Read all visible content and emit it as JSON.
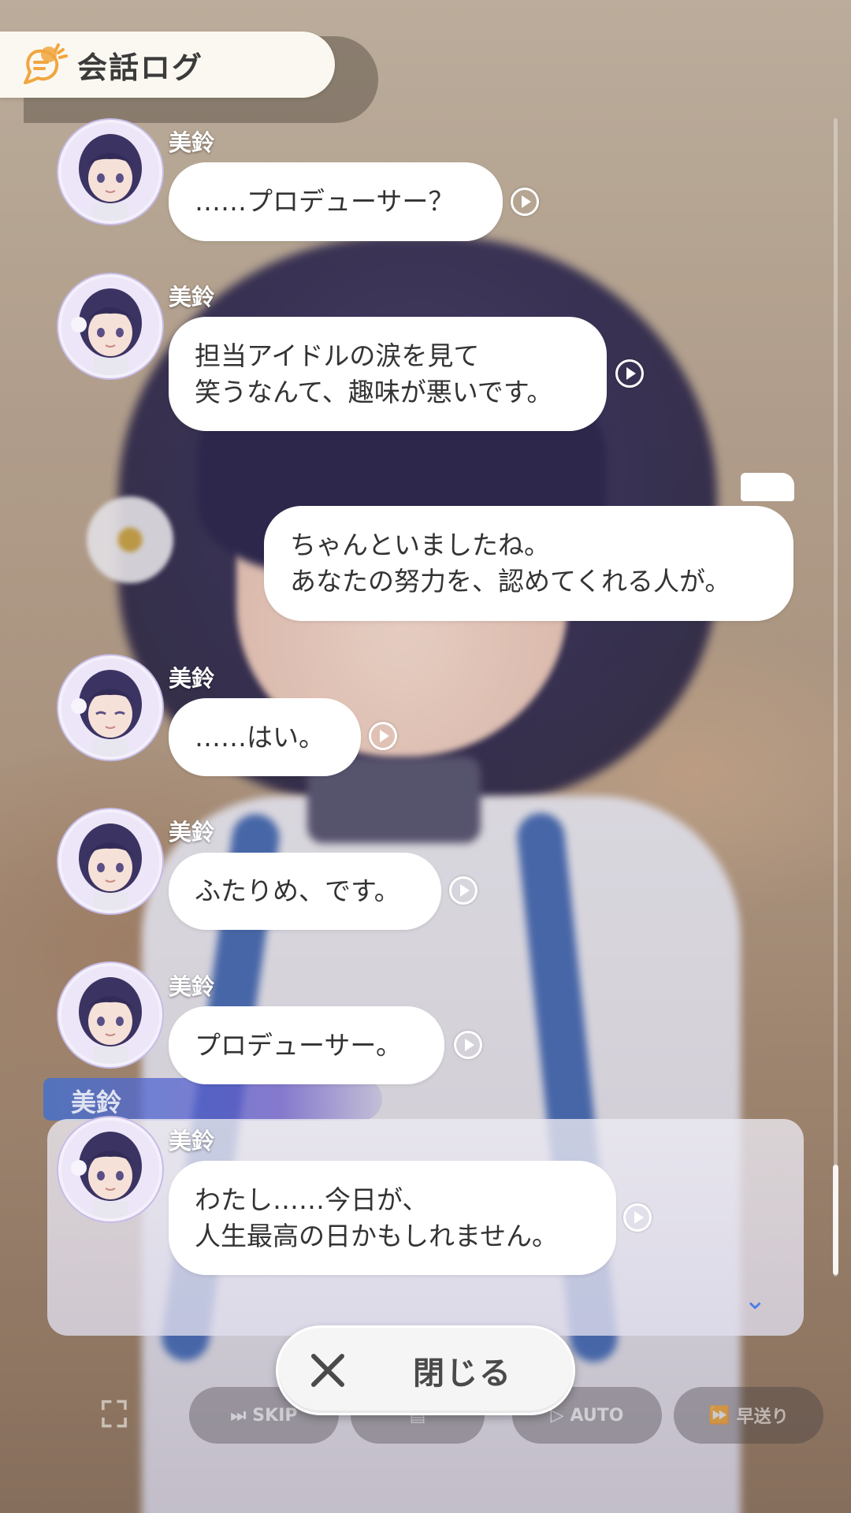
{
  "header": {
    "title": "会話ログ",
    "icon": "conversation-log-icon"
  },
  "entries": [
    {
      "speaker": "美鈴",
      "text": "……プロデューサー？",
      "side": "left",
      "has_voice": true
    },
    {
      "speaker": "美鈴",
      "text": "担当アイドルの涙を見て\n笑うなんて、趣味が悪いです。",
      "side": "left",
      "has_voice": true
    },
    {
      "speaker": "",
      "text": "ちゃんといましたね。\nあなたの努力を、認めてくれる人が。",
      "side": "right",
      "has_voice": false
    },
    {
      "speaker": "美鈴",
      "text": "……はい。",
      "side": "left",
      "has_voice": true
    },
    {
      "speaker": "美鈴",
      "text": "ふたりめ、です。",
      "side": "left",
      "has_voice": true
    },
    {
      "speaker": "美鈴",
      "text": "プロデューサー。",
      "side": "left",
      "has_voice": true
    },
    {
      "speaker": "美鈴",
      "text": "わたし……今日が、\n人生最高の日かもしれません。",
      "side": "left",
      "has_voice": true
    }
  ],
  "background": {
    "dialog_name": "美鈴",
    "controls": [
      {
        "label": "SKIP",
        "icon": "skip-icon"
      },
      {
        "label": "",
        "icon": "log-icon"
      },
      {
        "label": "AUTO",
        "icon": "auto-icon"
      },
      {
        "label": "早送り",
        "icon": "fast-forward-icon"
      }
    ]
  },
  "close_button": {
    "label": "閉じる",
    "icon": "close-icon"
  },
  "colors": {
    "header_bg": "#fbf8f1",
    "header_icon": "#f0a640",
    "bubble_bg": "#ffffff",
    "text": "#333333",
    "name_bar": "#3a6ed8"
  }
}
